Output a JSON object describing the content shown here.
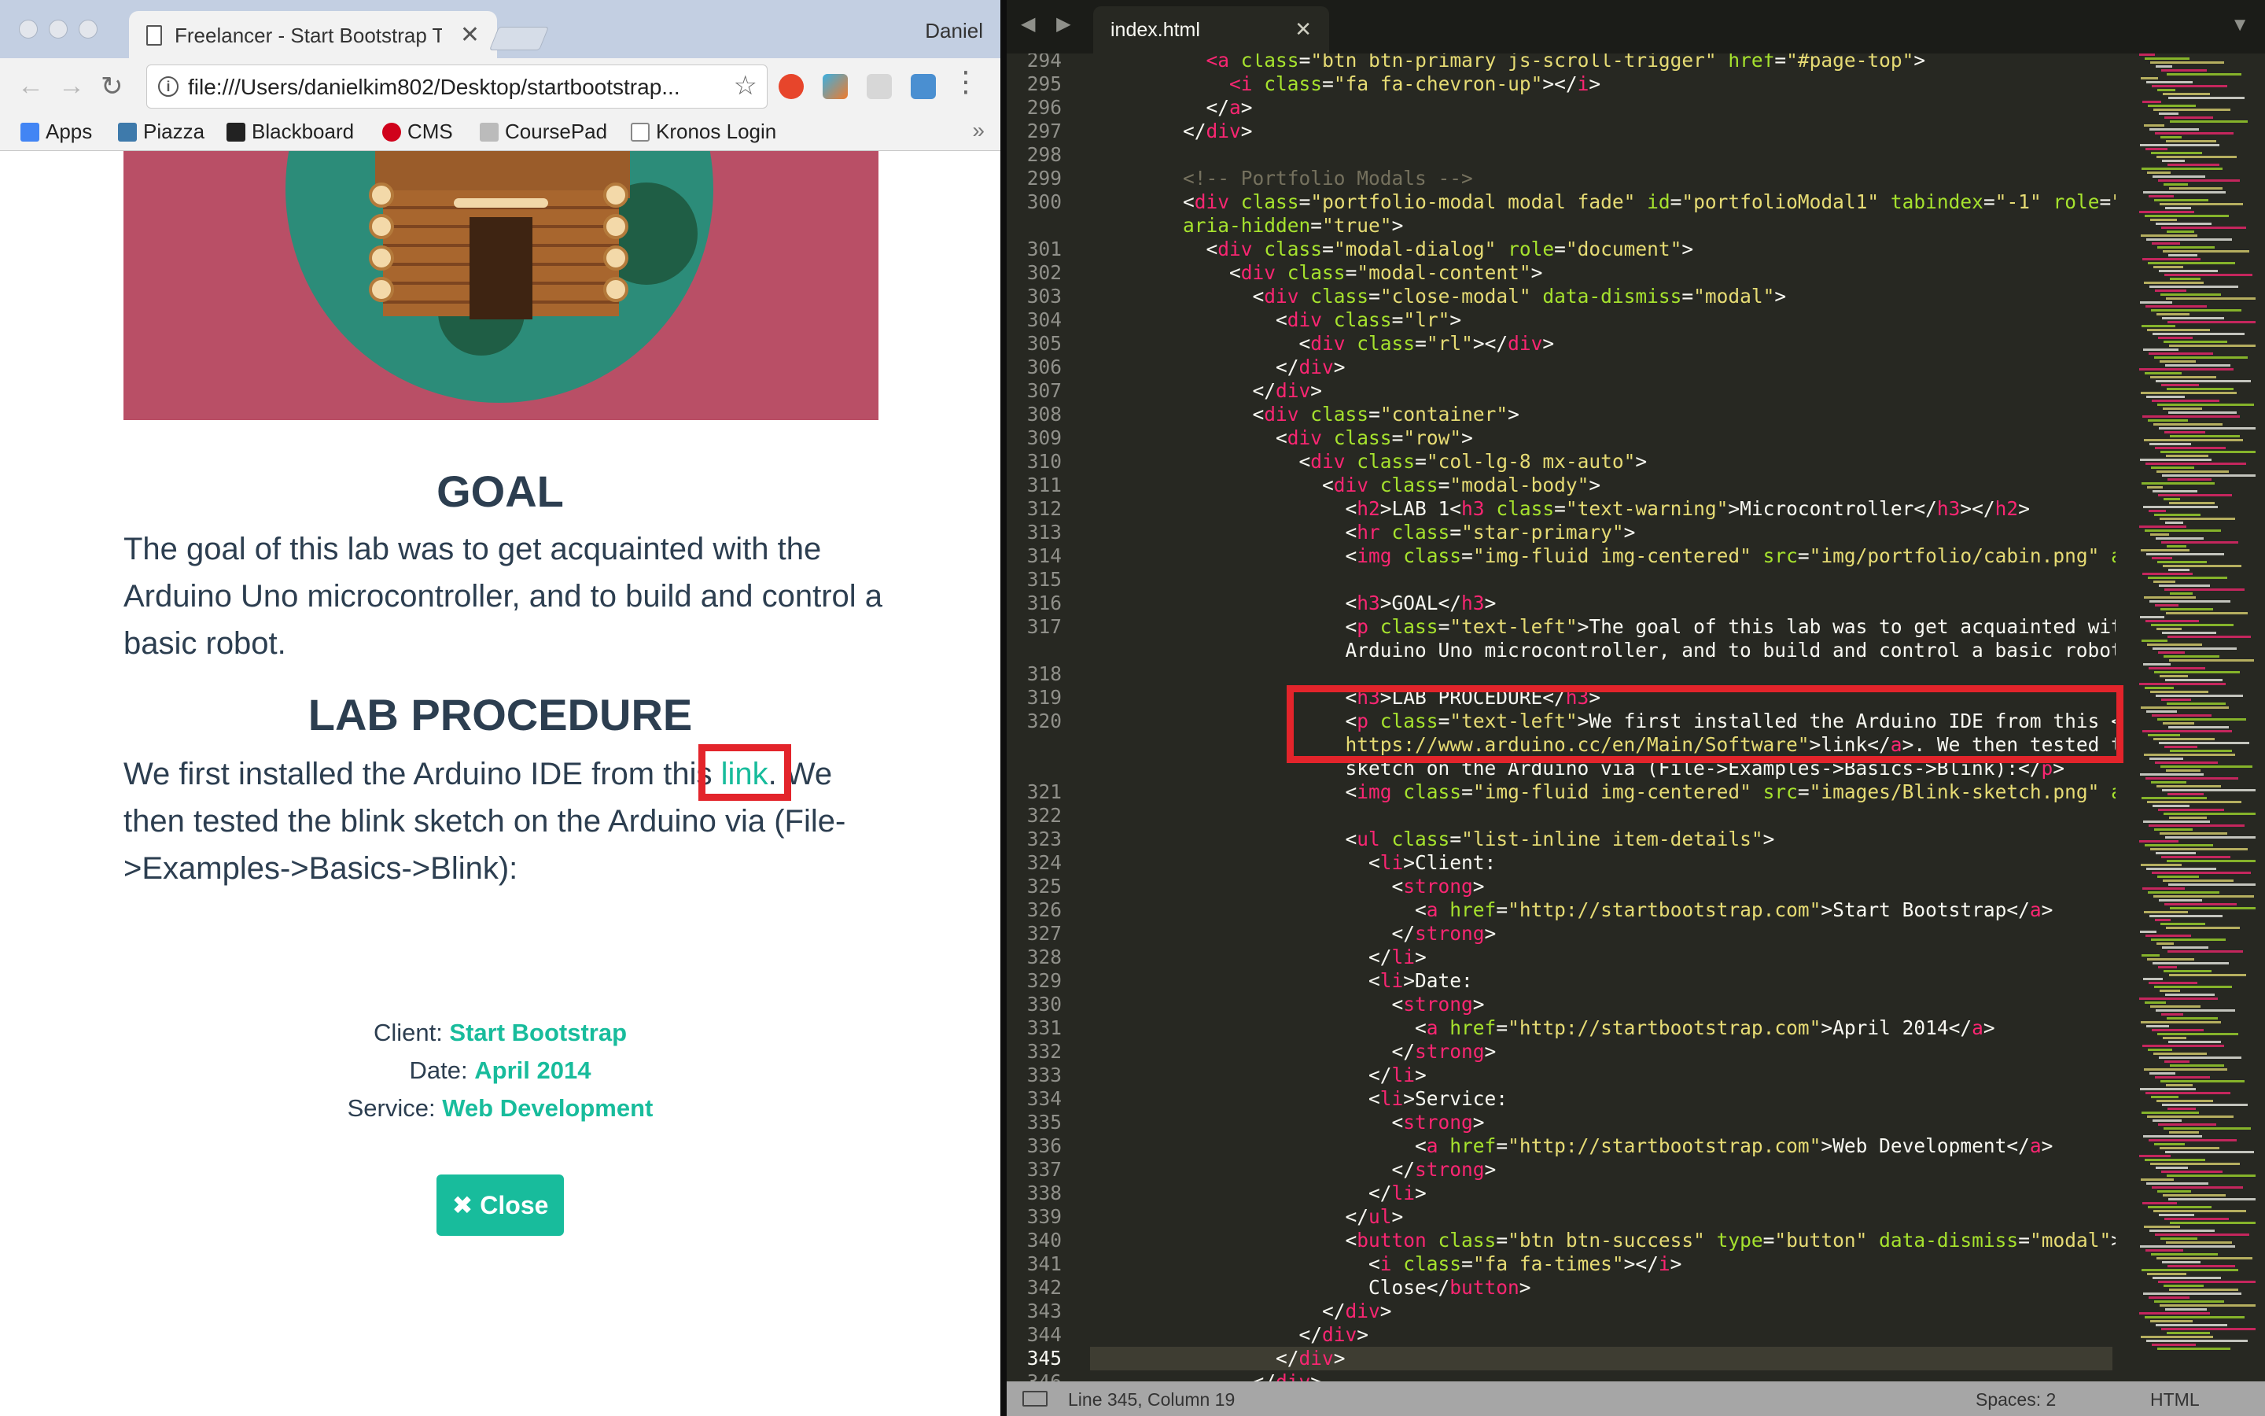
{
  "browser": {
    "tab_title": "Freelancer - Start Bootstrap Th",
    "tab_close": "✕",
    "profile_name": "Daniel",
    "url": "file:///Users/danielkim802/Desktop/startbootstrap...",
    "nav": {
      "back": "←",
      "forward": "→",
      "reload": "↻",
      "star": "☆",
      "menu": "⋮"
    },
    "bookmarks": [
      {
        "label": "Apps",
        "icon": "apps-grid-icon",
        "color": "#4285f4"
      },
      {
        "label": "Piazza",
        "icon": "piazza-icon",
        "color": "#3e7aab"
      },
      {
        "label": "Blackboard",
        "icon": "blackboard-icon",
        "color": "#222222"
      },
      {
        "label": "CMS",
        "icon": "cms-icon",
        "color": "#d0021b"
      },
      {
        "label": "CoursePad",
        "icon": "coursepad-icon",
        "color": "#888888"
      },
      {
        "label": "Kronos Login",
        "icon": "page-icon",
        "color": "#888888"
      }
    ],
    "bookmarks_more": "»"
  },
  "page": {
    "goal_heading": "GOAL",
    "goal_text_1": "The goal of this lab was to get acquainted with the",
    "goal_text_2": "Arduino Uno microcontroller, and to build and control a",
    "goal_text_3": "basic robot.",
    "lab_heading": "LAB PROCEDURE",
    "lab_text_1_before": "We first installed the Arduino IDE from this ",
    "lab_link": "link",
    "lab_text_1_after": ". We",
    "lab_text_2": "then tested the blink sketch on the Arduino via (File-",
    "lab_text_3": ">Examples->Basics->Blink):",
    "client_label": "Client: ",
    "client_value": "Start Bootstrap",
    "date_label": "Date: ",
    "date_value": "April 2014",
    "service_label": "Service: ",
    "service_value": "Web Development",
    "close_icon": "✖",
    "close_label": "Close",
    "accent_color": "#18bc9c",
    "hero_color": "#b94f66"
  },
  "editor": {
    "tab_title": "index.html",
    "tab_close": "✕",
    "dropdown": "▼",
    "nav_arrows": "◀ ▶",
    "current_line": 345,
    "code_lines": [
      {
        "n": "294",
        "html": "          <span class='tg'>&lt;a</span> <span class='at'>class</span>=<span class='st'>\"btn btn-primary js-scroll-trigger\"</span> <span class='at'>href</span>=<span class='st'>\"#page-top\"</span>&gt;"
      },
      {
        "n": "295",
        "html": "            <span class='tg'>&lt;i</span> <span class='at'>class</span>=<span class='st'>\"fa fa-chevron-up\"</span>&gt;&lt;/<span class='tg'>i</span>&gt;"
      },
      {
        "n": "296",
        "html": "          &lt;/<span class='tg'>a</span>&gt;"
      },
      {
        "n": "297",
        "html": "        &lt;/<span class='tg'>div</span>&gt;"
      },
      {
        "n": "298",
        "html": ""
      },
      {
        "n": "299",
        "html": "        <span class='cm'>&lt;!-- Portfolio Modals --&gt;</span>"
      },
      {
        "n": "300",
        "html": "        &lt;<span class='tg'>div</span> <span class='at'>class</span>=<span class='st'>\"portfolio-modal modal fade\"</span> <span class='at'>id</span>=<span class='st'>\"portfolioModal1\"</span> <span class='at'>tabindex</span>=<span class='st'>\"-1\"</span> <span class='at'>role</span>=<span class='st'>\"dialog\"</span>"
      },
      {
        "n": "",
        "html": "        <span class='at'>aria-hidden</span>=<span class='st'>\"true\"</span>&gt;"
      },
      {
        "n": "301",
        "html": "          &lt;<span class='tg'>div</span> <span class='at'>class</span>=<span class='st'>\"modal-dialog\"</span> <span class='at'>role</span>=<span class='st'>\"document\"</span>&gt;"
      },
      {
        "n": "302",
        "html": "            &lt;<span class='tg'>div</span> <span class='at'>class</span>=<span class='st'>\"modal-content\"</span>&gt;"
      },
      {
        "n": "303",
        "html": "              &lt;<span class='tg'>div</span> <span class='at'>class</span>=<span class='st'>\"close-modal\"</span> <span class='at'>data-dismiss</span>=<span class='st'>\"modal\"</span>&gt;"
      },
      {
        "n": "304",
        "html": "                &lt;<span class='tg'>div</span> <span class='at'>class</span>=<span class='st'>\"lr\"</span>&gt;"
      },
      {
        "n": "305",
        "html": "                  &lt;<span class='tg'>div</span> <span class='at'>class</span>=<span class='st'>\"rl\"</span>&gt;&lt;/<span class='tg'>div</span>&gt;"
      },
      {
        "n": "306",
        "html": "                &lt;/<span class='tg'>div</span>&gt;"
      },
      {
        "n": "307",
        "html": "              &lt;/<span class='tg'>div</span>&gt;"
      },
      {
        "n": "308",
        "html": "              &lt;<span class='tg'>div</span> <span class='at'>class</span>=<span class='st'>\"container\"</span>&gt;"
      },
      {
        "n": "309",
        "html": "                &lt;<span class='tg'>div</span> <span class='at'>class</span>=<span class='st'>\"row\"</span>&gt;"
      },
      {
        "n": "310",
        "html": "                  &lt;<span class='tg'>div</span> <span class='at'>class</span>=<span class='st'>\"col-lg-8 mx-auto\"</span>&gt;"
      },
      {
        "n": "311",
        "html": "                    &lt;<span class='tg'>div</span> <span class='at'>class</span>=<span class='st'>\"modal-body\"</span>&gt;"
      },
      {
        "n": "312",
        "html": "                      &lt;<span class='tg'>h2</span>&gt;LAB 1&lt;<span class='tg'>h3</span> <span class='at'>class</span>=<span class='st'>\"text-warning\"</span>&gt;Microcontroller&lt;/<span class='tg'>h3</span>&gt;&lt;/<span class='tg'>h2</span>&gt;"
      },
      {
        "n": "313",
        "html": "                      &lt;<span class='tg'>hr</span> <span class='at'>class</span>=<span class='st'>\"star-primary\"</span>&gt;"
      },
      {
        "n": "314",
        "html": "                      &lt;<span class='tg'>img</span> <span class='at'>class</span>=<span class='st'>\"img-fluid img-centered\"</span> <span class='at'>src</span>=<span class='st'>\"img/portfolio/cabin.png\"</span> <span class='at'>alt</span>=<span class='st'>\"\"</span>&gt;"
      },
      {
        "n": "315",
        "html": ""
      },
      {
        "n": "316",
        "html": "                      &lt;<span class='tg'>h3</span>&gt;GOAL&lt;/<span class='tg'>h3</span>&gt;"
      },
      {
        "n": "317",
        "html": "                      &lt;<span class='tg'>p</span> <span class='at'>class</span>=<span class='st'>\"text-left\"</span>&gt;The goal of this lab was to get acquainted with the"
      },
      {
        "n": "",
        "html": "                      Arduino Uno microcontroller, and to build and control a basic robot.&lt;/<span class='tg'>p</span>&gt;"
      },
      {
        "n": "318",
        "html": ""
      },
      {
        "n": "319",
        "html": "                      &lt;<span class='tg'>h3</span>&gt;LAB PROCEDURE&lt;/<span class='tg'>h3</span>&gt;"
      },
      {
        "n": "320",
        "html": "                      &lt;<span class='tg'>p</span> <span class='at'>class</span>=<span class='st'>\"text-left\"</span>&gt;We first installed the Arduino IDE from this &lt;<span class='tg'>a</span> <span class='at'>href</span>=<span class='st'>\"</span>"
      },
      {
        "n": "",
        "html": "                      <span class='st'>https://www.arduino.cc/en/Main/Software\"</span>&gt;link&lt;/<span class='tg'>a</span>&gt;. We then tested the blink"
      },
      {
        "n": "",
        "html": "                      sketch on the Arduino via (File-&gt;Examples-&gt;Basics-&gt;Blink):&lt;/<span class='tg'>p</span>&gt;"
      },
      {
        "n": "321",
        "html": "                      &lt;<span class='tg'>img</span> <span class='at'>class</span>=<span class='st'>\"img-fluid img-centered\"</span> <span class='at'>src</span>=<span class='st'>\"images/Blink-sketch.png\"</span> <span class='at'>alt</span>=<span class='st'>\"\"</span>&gt;"
      },
      {
        "n": "322",
        "html": ""
      },
      {
        "n": "323",
        "html": "                      &lt;<span class='tg'>ul</span> <span class='at'>class</span>=<span class='st'>\"list-inline item-details\"</span>&gt;"
      },
      {
        "n": "324",
        "html": "                        &lt;<span class='tg'>li</span>&gt;Client:"
      },
      {
        "n": "325",
        "html": "                          &lt;<span class='tg'>strong</span>&gt;"
      },
      {
        "n": "326",
        "html": "                            &lt;<span class='tg'>a</span> <span class='at'>href</span>=<span class='st'>\"http://startbootstrap.com\"</span>&gt;Start Bootstrap&lt;/<span class='tg'>a</span>&gt;"
      },
      {
        "n": "327",
        "html": "                          &lt;/<span class='tg'>strong</span>&gt;"
      },
      {
        "n": "328",
        "html": "                        &lt;/<span class='tg'>li</span>&gt;"
      },
      {
        "n": "329",
        "html": "                        &lt;<span class='tg'>li</span>&gt;Date:"
      },
      {
        "n": "330",
        "html": "                          &lt;<span class='tg'>strong</span>&gt;"
      },
      {
        "n": "331",
        "html": "                            &lt;<span class='tg'>a</span> <span class='at'>href</span>=<span class='st'>\"http://startbootstrap.com\"</span>&gt;April 2014&lt;/<span class='tg'>a</span>&gt;"
      },
      {
        "n": "332",
        "html": "                          &lt;/<span class='tg'>strong</span>&gt;"
      },
      {
        "n": "333",
        "html": "                        &lt;/<span class='tg'>li</span>&gt;"
      },
      {
        "n": "334",
        "html": "                        &lt;<span class='tg'>li</span>&gt;Service:"
      },
      {
        "n": "335",
        "html": "                          &lt;<span class='tg'>strong</span>&gt;"
      },
      {
        "n": "336",
        "html": "                            &lt;<span class='tg'>a</span> <span class='at'>href</span>=<span class='st'>\"http://startbootstrap.com\"</span>&gt;Web Development&lt;/<span class='tg'>a</span>&gt;"
      },
      {
        "n": "337",
        "html": "                          &lt;/<span class='tg'>strong</span>&gt;"
      },
      {
        "n": "338",
        "html": "                        &lt;/<span class='tg'>li</span>&gt;"
      },
      {
        "n": "339",
        "html": "                      &lt;/<span class='tg'>ul</span>&gt;"
      },
      {
        "n": "340",
        "html": "                      &lt;<span class='tg'>button</span> <span class='at'>class</span>=<span class='st'>\"btn btn-success\"</span> <span class='at'>type</span>=<span class='st'>\"button\"</span> <span class='at'>data-dismiss</span>=<span class='st'>\"modal\"</span>&gt;"
      },
      {
        "n": "341",
        "html": "                        &lt;<span class='tg'>i</span> <span class='at'>class</span>=<span class='st'>\"fa fa-times\"</span>&gt;&lt;/<span class='tg'>i</span>&gt;"
      },
      {
        "n": "342",
        "html": "                        Close&lt;/<span class='tg'>button</span>&gt;"
      },
      {
        "n": "343",
        "html": "                    &lt;/<span class='tg'>div</span>&gt;"
      },
      {
        "n": "344",
        "html": "                  &lt;/<span class='tg'>div</span>&gt;"
      },
      {
        "n": "345",
        "html": "                &lt;/<span class='tg'>div</span>&gt;"
      },
      {
        "n": "346",
        "html": "              &lt;/<span class='tg'>div</span>&gt;"
      }
    ],
    "status_position": "Line 345, Column 19",
    "status_spaces": "Spaces: 2",
    "status_syntax": "HTML"
  }
}
